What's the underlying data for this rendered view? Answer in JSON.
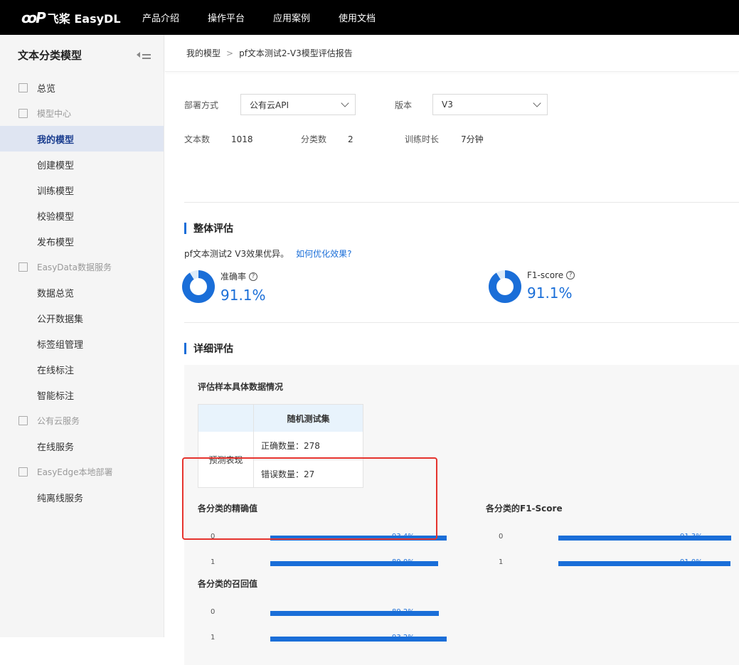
{
  "brand": {
    "mark": "ꝏP",
    "name": "飞桨 EasyDL"
  },
  "nav": [
    "产品介绍",
    "操作平台",
    "应用案例",
    "使用文档"
  ],
  "sidebar": {
    "title": "文本分类模型",
    "groups": [
      {
        "label": "总览",
        "primary": true,
        "items": []
      },
      {
        "label": "模型中心",
        "primary": false,
        "items": [
          "我的模型",
          "创建模型",
          "训练模型",
          "校验模型",
          "发布模型"
        ]
      },
      {
        "label": "EasyData数据服务",
        "primary": false,
        "items": [
          "数据总览",
          "公开数据集",
          "标签组管理",
          "在线标注",
          "智能标注"
        ]
      },
      {
        "label": "公有云服务",
        "primary": false,
        "items": [
          "在线服务"
        ]
      },
      {
        "label": "EasyEdge本地部署",
        "primary": false,
        "items": [
          "纯离线服务"
        ]
      }
    ],
    "active_item": "我的模型"
  },
  "breadcrumb": {
    "root": "我的模型",
    "sep": ">",
    "current": "pf文本测试2-V3模型评估报告"
  },
  "form": {
    "deploy_label": "部署方式",
    "deploy_value": "公有云API",
    "version_label": "版本",
    "version_value": "V3"
  },
  "stats": {
    "text_count_label": "文本数",
    "text_count": "1018",
    "class_count_label": "分类数",
    "class_count": "2",
    "train_time_label": "训练时长",
    "train_time": "7分钟"
  },
  "overall": {
    "title": "整体评估",
    "summary": "pf文本测试2 V3效果优异。",
    "link": "如何优化效果?",
    "accuracy_label": "准确率",
    "accuracy_value": "91.1%",
    "accuracy_fraction": 0.911,
    "f1_label": "F1-score",
    "f1_value": "91.1%",
    "f1_fraction": 0.911,
    "help_glyph": "?"
  },
  "detail": {
    "title": "详细评估",
    "panel_title": "评估样本具体数据情况",
    "table": {
      "header": "随机测试集",
      "row_label": "预测表现",
      "correct": "正确数量：278",
      "wrong": "错误数量：27"
    }
  },
  "colors": {
    "accent": "#1a6ed8",
    "highlight": "#e5332d",
    "donut_track": "#dcebf9"
  },
  "chart_data": [
    {
      "type": "bar",
      "title": "各分类的精确值",
      "categories": [
        "0",
        "1"
      ],
      "values": [
        93.4,
        89.0
      ],
      "labels": [
        "93.4%",
        "89.0%"
      ],
      "ylim": [
        0,
        100
      ]
    },
    {
      "type": "bar",
      "title": "各分类的F1-Score",
      "categories": [
        "0",
        "1"
      ],
      "values": [
        91.3,
        91.0
      ],
      "labels": [
        "91.3%",
        "91.0%"
      ],
      "ylim": [
        0,
        100
      ]
    },
    {
      "type": "bar",
      "title": "各分类的召回值",
      "categories": [
        "0",
        "1"
      ],
      "values": [
        89.2,
        93.2
      ],
      "labels": [
        "89.2%",
        "93.2%"
      ],
      "ylim": [
        0,
        100
      ]
    }
  ]
}
